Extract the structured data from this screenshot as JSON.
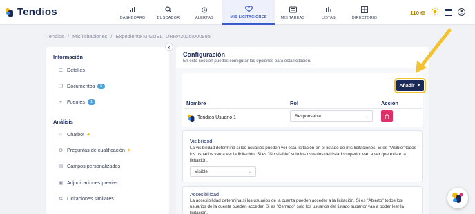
{
  "app": {
    "name": "Tendios"
  },
  "nav": [
    {
      "label": "DASHBOARD",
      "icon": "bar-chart-icon"
    },
    {
      "label": "BUSCADOR",
      "icon": "search-icon"
    },
    {
      "label": "ALERTAS",
      "icon": "alarm-clock-icon"
    },
    {
      "label": "MIS LICITACIONES",
      "icon": "heart-icon",
      "active": true
    },
    {
      "label": "MIS TAREAS",
      "icon": "tasks-icon"
    },
    {
      "label": "LISTAS",
      "icon": "list-icon"
    },
    {
      "label": "DIRECTORIO",
      "icon": "grid-icon"
    }
  ],
  "header": {
    "credits": "110"
  },
  "breadcrumb": [
    "Tendios",
    "/",
    "Mis licitaciones",
    "/",
    "Expediente MIGUELTURRA2025/000985"
  ],
  "sidebar": {
    "info_title": "Información",
    "analysis_title": "Análisis",
    "items": {
      "detalles": "Detalles",
      "documentos": "Documentos",
      "documentos_count": "5",
      "fuentes": "Fuentes",
      "fuentes_count": "1",
      "chatbot": "Chatbot",
      "preguntas": "Preguntas de cualificación",
      "campos": "Campos personalizados",
      "adjudicaciones": "Adjudicaciones previas",
      "similares": "Licitaciones similares"
    }
  },
  "main": {
    "title": "Configuración",
    "subtitle": "En esta sección puedes configurar las opciones para esta licitación.",
    "add_button": "Añadir",
    "table": {
      "col_name": "Nombre",
      "col_role": "Rol",
      "col_action": "Acción",
      "rows": [
        {
          "name": "Tendios Usuario 1",
          "role": "Responsable"
        }
      ]
    },
    "visibility": {
      "title": "Visibilidad",
      "text": "La visibilidad determina si los usuarios pueden ver esta licitación en el listado de mis licitaciones. Si es \"Visible\" todos los usuarios van a ver la licitación. Si es \"No visible\" solo los usuarios del listado superior van a ver que existe la licitación.",
      "value": "Visible"
    },
    "access": {
      "title": "Accesibilidad",
      "text": "La accesibilidad determina si los usuarios de la cuenta pueden acceder a la licitación. Si es \"Abierto\" todos los usuarios de la cuenta pueden acceder. Si es \"Cerrado\" solo los usuarios del listado superior van a poder leer la licitación."
    }
  },
  "colors": {
    "brand": "#1b2a58",
    "accent": "#f2c230",
    "danger": "#e0306c",
    "active_nav": "#3b5bcc"
  }
}
